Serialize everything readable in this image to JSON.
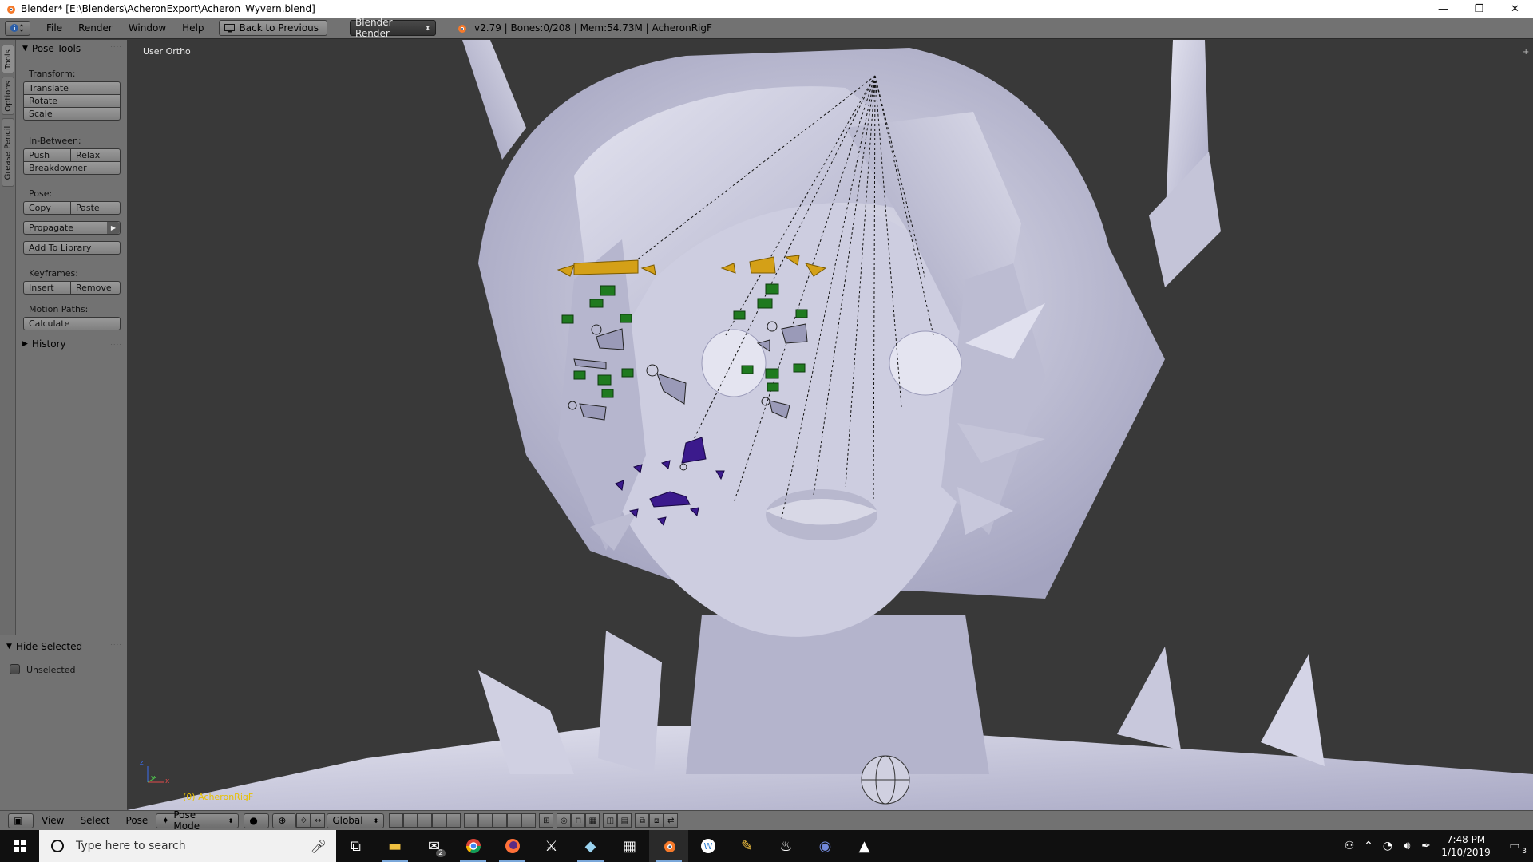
{
  "window": {
    "title": "Blender* [E:\\Blenders\\AcheronExport\\Acheron_Wyvern.blend]",
    "minimize": "—",
    "maximize": "❐",
    "close": "✕"
  },
  "info_header": {
    "menus": [
      "File",
      "Render",
      "Window",
      "Help"
    ],
    "back_button": "Back to Previous",
    "render_engine": "Blender Render",
    "stats": "v2.79 | Bones:0/208 | Mem:54.73M | AcheronRigF"
  },
  "tabs": [
    "Tools",
    "Options",
    "Grease Pencil"
  ],
  "pose_tools": {
    "title": "Pose Tools",
    "transform_label": "Transform:",
    "translate": "Translate",
    "rotate": "Rotate",
    "scale": "Scale",
    "inbetween_label": "In-Between:",
    "push": "Push",
    "relax": "Relax",
    "breakdowner": "Breakdowner",
    "pose_label": "Pose:",
    "copy": "Copy",
    "paste": "Paste",
    "propagate": "Propagate",
    "add_to_library": "Add To Library",
    "keyframes_label": "Keyframes:",
    "insert": "Insert",
    "remove": "Remove",
    "motion_paths_label": "Motion Paths:",
    "calculate": "Calculate"
  },
  "history": {
    "title": "History"
  },
  "hide_selected": {
    "title": "Hide Selected",
    "unselected": "Unselected"
  },
  "viewport": {
    "view_name": "User Ortho",
    "object_label": "(0) AcheronRigF",
    "axis_y": "y",
    "axis_z": "z",
    "axis_x": "x"
  },
  "view3d_header": {
    "menus": [
      "View",
      "Select",
      "Pose"
    ],
    "mode": "Pose Mode",
    "orientation": "Global"
  },
  "taskbar": {
    "search_placeholder": "Type here to search",
    "mail_badge": "2",
    "time": "7:48 PM",
    "date": "1/10/2019",
    "notification_count": "3"
  },
  "colors": {
    "bone_yellow": "#d4a017",
    "bone_green": "#1f7a1f",
    "bone_purple": "#3b1a8c",
    "mesh": "#c8c8dc"
  }
}
